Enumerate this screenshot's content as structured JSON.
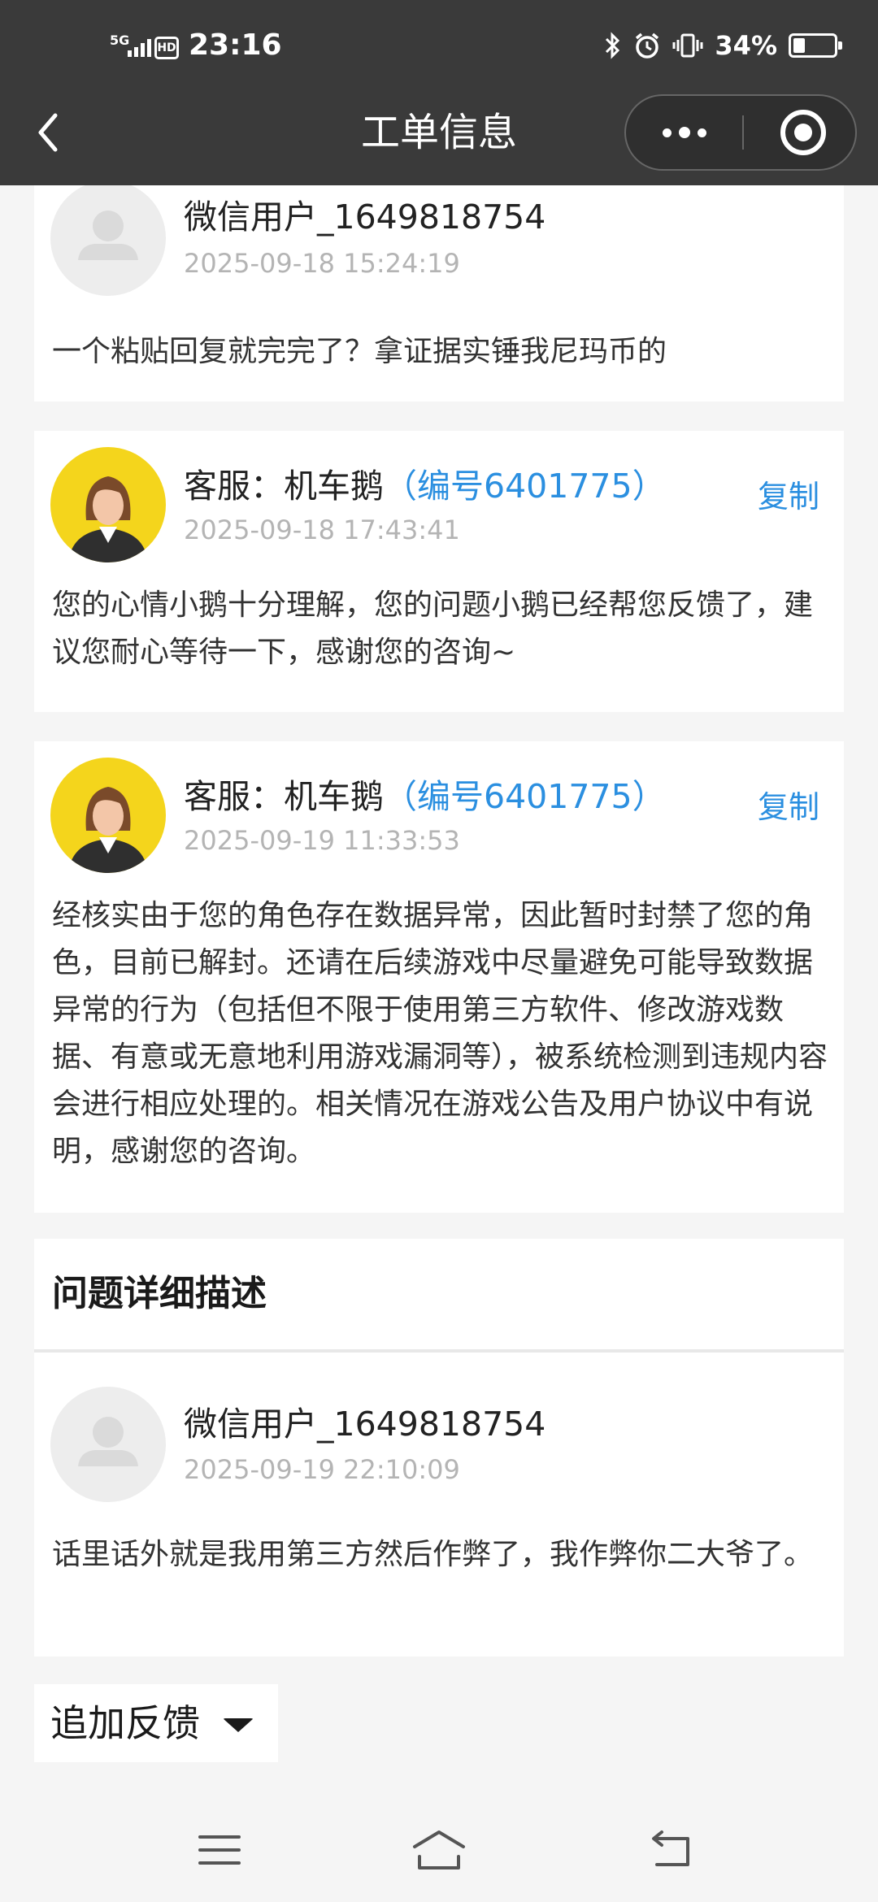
{
  "status_bar": {
    "network": "5G",
    "hd": "HD",
    "time": "23:16",
    "battery": "34%"
  },
  "nav": {
    "title": "工单信息"
  },
  "messages": [
    {
      "role": "user",
      "name": "微信用户_1649818754",
      "time": "2025-09-18 15:24:19",
      "text": "一个粘贴回复就完完了？拿证据实锤我尼玛币的"
    },
    {
      "role": "agent",
      "name": "客服：机车鹅",
      "agent_id": "（编号6401775）",
      "copy_label": "复制",
      "time": "2025-09-18 17:43:41",
      "text": "您的心情小鹅十分理解，您的问题小鹅已经帮您反馈了，建议您耐心等待一下，感谢您的咨询~"
    },
    {
      "role": "agent",
      "name": "客服：机车鹅",
      "agent_id": "（编号6401775）",
      "copy_label": "复制",
      "time": "2025-09-19 11:33:53",
      "text": "经核实由于您的角色存在数据异常，因此暂时封禁了您的角色，目前已解封。还请在后续游戏中尽量避免可能导致数据异常的行为（包括但不限于使用第三方软件、修改游戏数据、有意或无意地利用游戏漏洞等），被系统检测到违规内容会进行相应处理的。相关情况在游戏公告及用户协议中有说明，感谢您的咨询。"
    }
  ],
  "detail_section": {
    "title": "问题详细描述",
    "message": {
      "role": "user",
      "name": "微信用户_1649818754",
      "time": "2025-09-19 22:10:09",
      "text": "话里话外就是我用第三方然后作弊了，我作弊你二大爷了。"
    }
  },
  "add_feedback": {
    "label": "追加反馈"
  },
  "colors": {
    "topbar": "#3a3a3a",
    "link": "#2b8fe0",
    "agent_avatar_bg": "#f4d51c"
  }
}
